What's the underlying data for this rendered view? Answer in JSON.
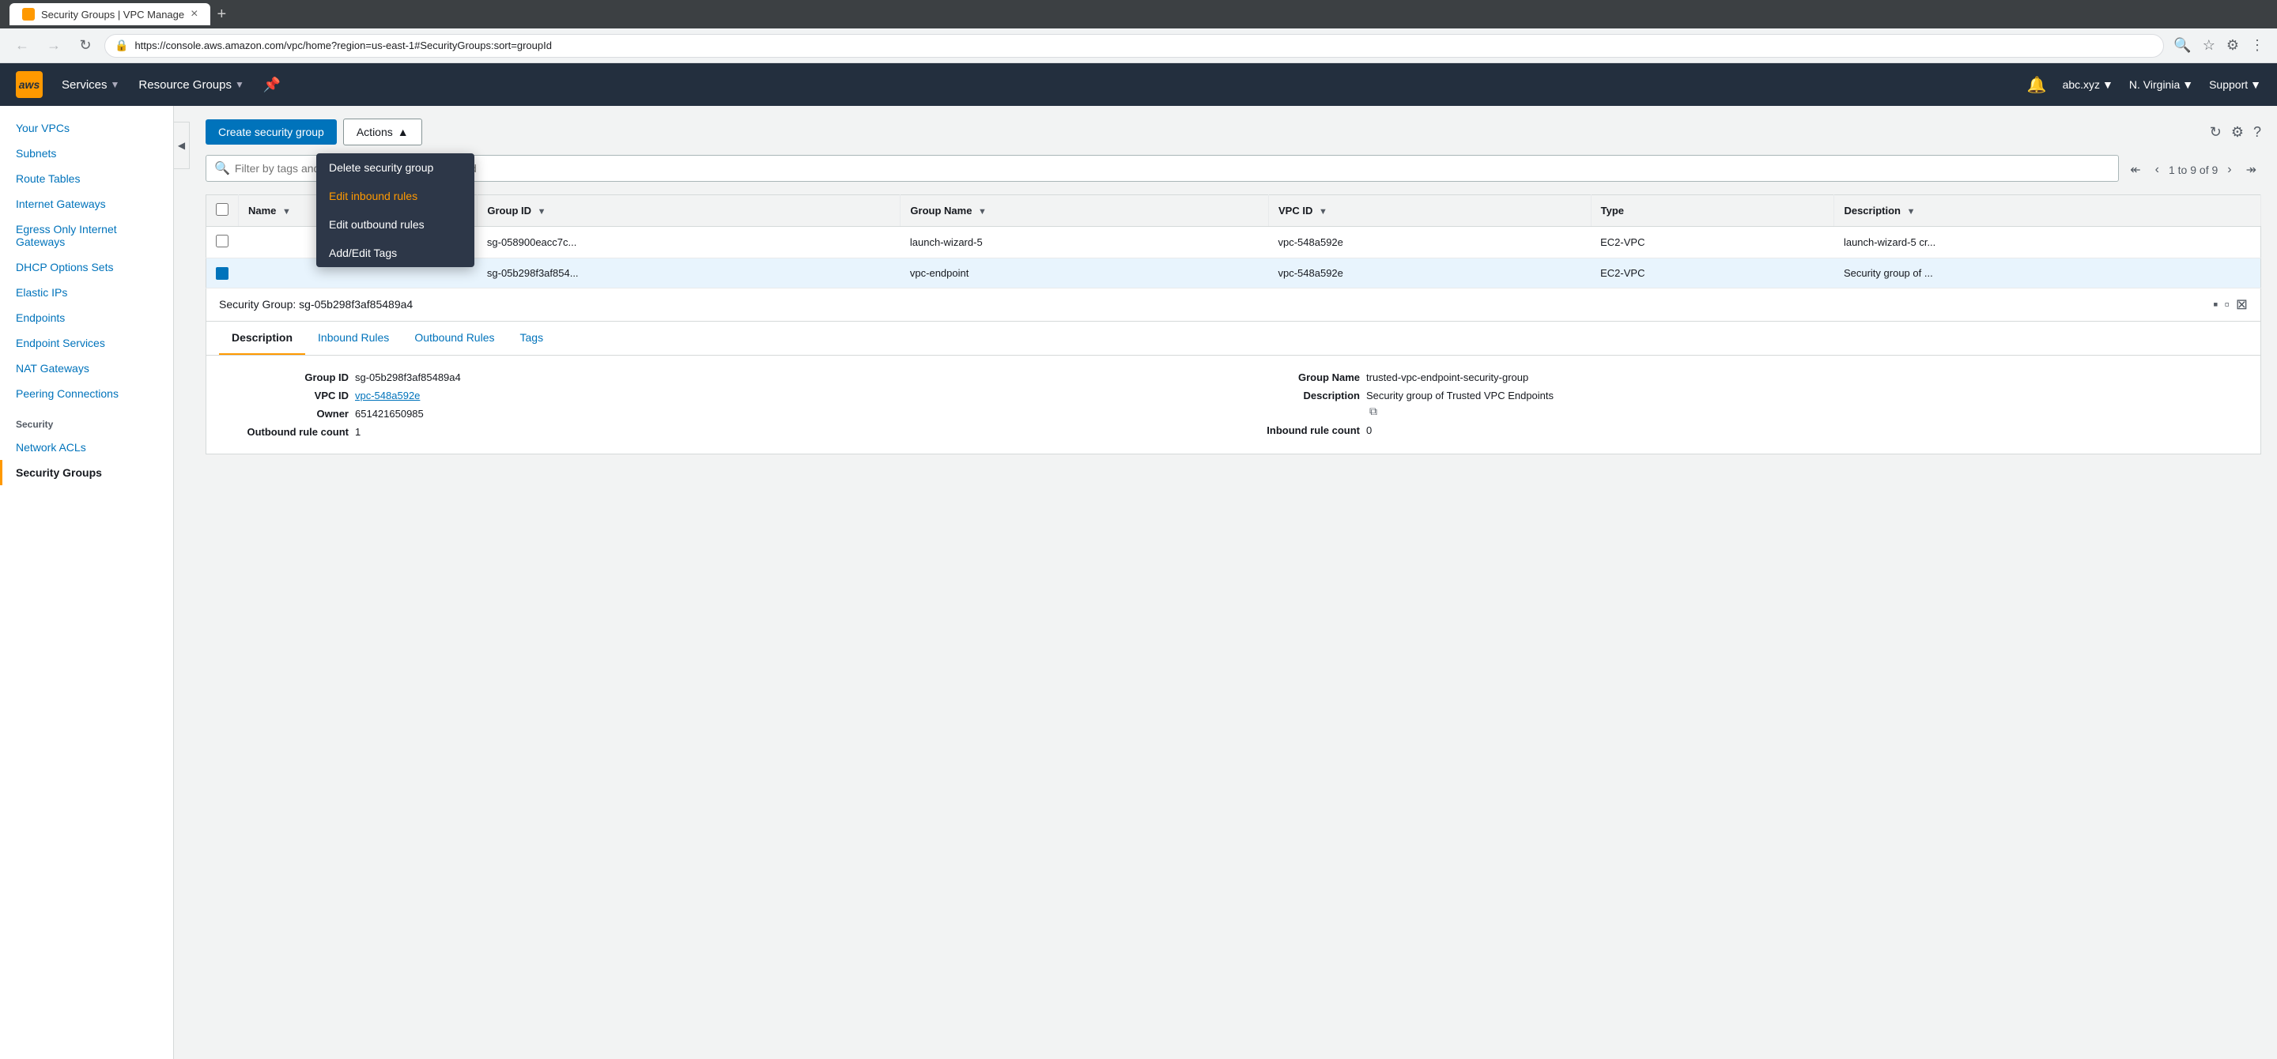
{
  "browser": {
    "tab_title": "Security Groups | VPC Manage",
    "tab_favicon": "📦",
    "url": "https://console.aws.amazon.com/vpc/home?region=us-east-1#SecurityGroups:sort=groupId",
    "new_tab_label": "+"
  },
  "topnav": {
    "logo_text": "aws",
    "services_label": "Services",
    "resource_groups_label": "Resource Groups",
    "account_label": "abc.xyz",
    "region_label": "N. Virginia",
    "support_label": "Support"
  },
  "sidebar": {
    "items": [
      {
        "label": "Your VPCs",
        "active": false
      },
      {
        "label": "Subnets",
        "active": false
      },
      {
        "label": "Route Tables",
        "active": false
      },
      {
        "label": "Internet Gateways",
        "active": false
      },
      {
        "label": "Egress Only Internet Gateways",
        "active": false
      },
      {
        "label": "DHCP Options Sets",
        "active": false
      },
      {
        "label": "Elastic IPs",
        "active": false
      },
      {
        "label": "Endpoints",
        "active": false
      },
      {
        "label": "Endpoint Services",
        "active": false
      },
      {
        "label": "NAT Gateways",
        "active": false
      },
      {
        "label": "Peering Connections",
        "active": false
      }
    ],
    "security_section_label": "Security",
    "security_items": [
      {
        "label": "Network ACLs",
        "active": false
      },
      {
        "label": "Security Groups",
        "active": true
      }
    ]
  },
  "toolbar": {
    "create_button_label": "Create security group",
    "actions_button_label": "Actions"
  },
  "actions_menu": {
    "items": [
      {
        "label": "Delete security group",
        "style": "normal"
      },
      {
        "label": "Edit inbound rules",
        "style": "orange"
      },
      {
        "label": "Edit outbound rules",
        "style": "normal"
      },
      {
        "label": "Add/Edit Tags",
        "style": "normal"
      }
    ]
  },
  "filter": {
    "placeholder": "Filter by tags and attributes or search by keyword"
  },
  "pagination": {
    "label": "1 to 9 of 9"
  },
  "table": {
    "columns": [
      {
        "label": "Name"
      },
      {
        "label": "Group ID"
      },
      {
        "label": "Group Name"
      },
      {
        "label": "VPC ID"
      },
      {
        "label": "Type"
      },
      {
        "label": "Description"
      }
    ],
    "rows": [
      {
        "selected": false,
        "name": "",
        "group_id": "sg-058900eacc7c...",
        "group_name": "launch-wizard-5",
        "vpc_id": "vpc-548a592e",
        "type": "EC2-VPC",
        "description": "launch-wizard-5 cr..."
      },
      {
        "selected": true,
        "name": "",
        "group_id": "sg-05b298f3af854...",
        "group_name": "vpc-endpoint",
        "vpc_id": "vpc-548a592e",
        "type": "EC2-VPC",
        "description": "Security group of ..."
      }
    ]
  },
  "detail_panel": {
    "header_title": "Security Group: sg-05b298f3af85489a4",
    "tabs": [
      {
        "label": "Description",
        "active": true
      },
      {
        "label": "Inbound Rules",
        "active": false
      },
      {
        "label": "Outbound Rules",
        "active": false
      },
      {
        "label": "Tags",
        "active": false
      }
    ],
    "fields_left": [
      {
        "label": "Group ID",
        "value": "sg-05b298f3af85489a4",
        "link": false
      },
      {
        "label": "VPC ID",
        "value": "vpc-548a592e",
        "link": true
      },
      {
        "label": "Owner",
        "value": "651421650985",
        "link": false
      },
      {
        "label": "Outbound rule count",
        "value": "1",
        "link": false
      }
    ],
    "fields_right": [
      {
        "label": "Group Name",
        "value": "trusted-vpc-endpoint-security-group",
        "link": false
      },
      {
        "label": "Description",
        "value": "Security group of Trusted VPC Endpoints",
        "link": false
      },
      {
        "label": "Inbound rule count",
        "value": "0",
        "link": false
      }
    ]
  }
}
